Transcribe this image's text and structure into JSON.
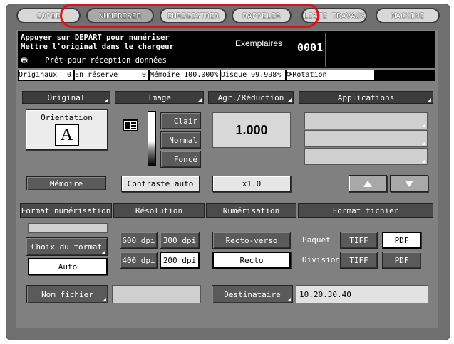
{
  "tabs": [
    {
      "label": "COPIE"
    },
    {
      "label": "NUMÉRISER"
    },
    {
      "label": "ENREGISTRER"
    },
    {
      "label": "RAPPELER"
    },
    {
      "label": "LISTE TRAVAUX"
    },
    {
      "label": "MACHINE"
    }
  ],
  "message": {
    "line1": "Appuyer sur DEPART pour numériser",
    "line2": "Mettre l'original dans le chargeur",
    "line3": "Prêt pour réception données",
    "copies_label": "Exemplaires",
    "copies_value": "0001"
  },
  "status": {
    "originals_label": "Originaux",
    "originals_value": "0",
    "reserve_label": "En réserve",
    "reserve_value": "0",
    "memory": "Mémoire 100.000%",
    "disk": "Disque  99.998%",
    "rotation": "Rotation"
  },
  "original": {
    "header": "Original",
    "orientation_label": "Orientation",
    "orientation_letter": "A",
    "memory_button": "Mémoire"
  },
  "image": {
    "header": "Image",
    "light": "Clair",
    "normal": "Normal",
    "dark": "Foncé",
    "auto_contrast": "Contraste auto"
  },
  "zoom": {
    "header": "Agr./Réduction",
    "value": "1.000",
    "x1_button": "x1.0"
  },
  "applications": {
    "header": "Applications"
  },
  "scan_format": {
    "header": "Format numérisation",
    "choose_button": "Choix du format",
    "auto_button": "Auto"
  },
  "resolution": {
    "header": "Résolution",
    "dpi600": "600 dpi",
    "dpi300": "300 dpi",
    "dpi400": "400 dpi",
    "dpi200": "200 dpi"
  },
  "scanning": {
    "header": "Numérisation",
    "duplex": "Recto-verso",
    "simplex": "Recto"
  },
  "file_format": {
    "header": "Format fichier",
    "batch_label": "Paquet",
    "division_label": "Division",
    "tiff": "TIFF",
    "pdf": "PDF"
  },
  "filename": {
    "button": "Nom fichier",
    "value": ""
  },
  "destination": {
    "button": "Destinataire",
    "value": "10.20.30.40"
  },
  "colors": {
    "highlight": "#e0101a",
    "panel": "#808080",
    "header": "#3c3c3c"
  }
}
